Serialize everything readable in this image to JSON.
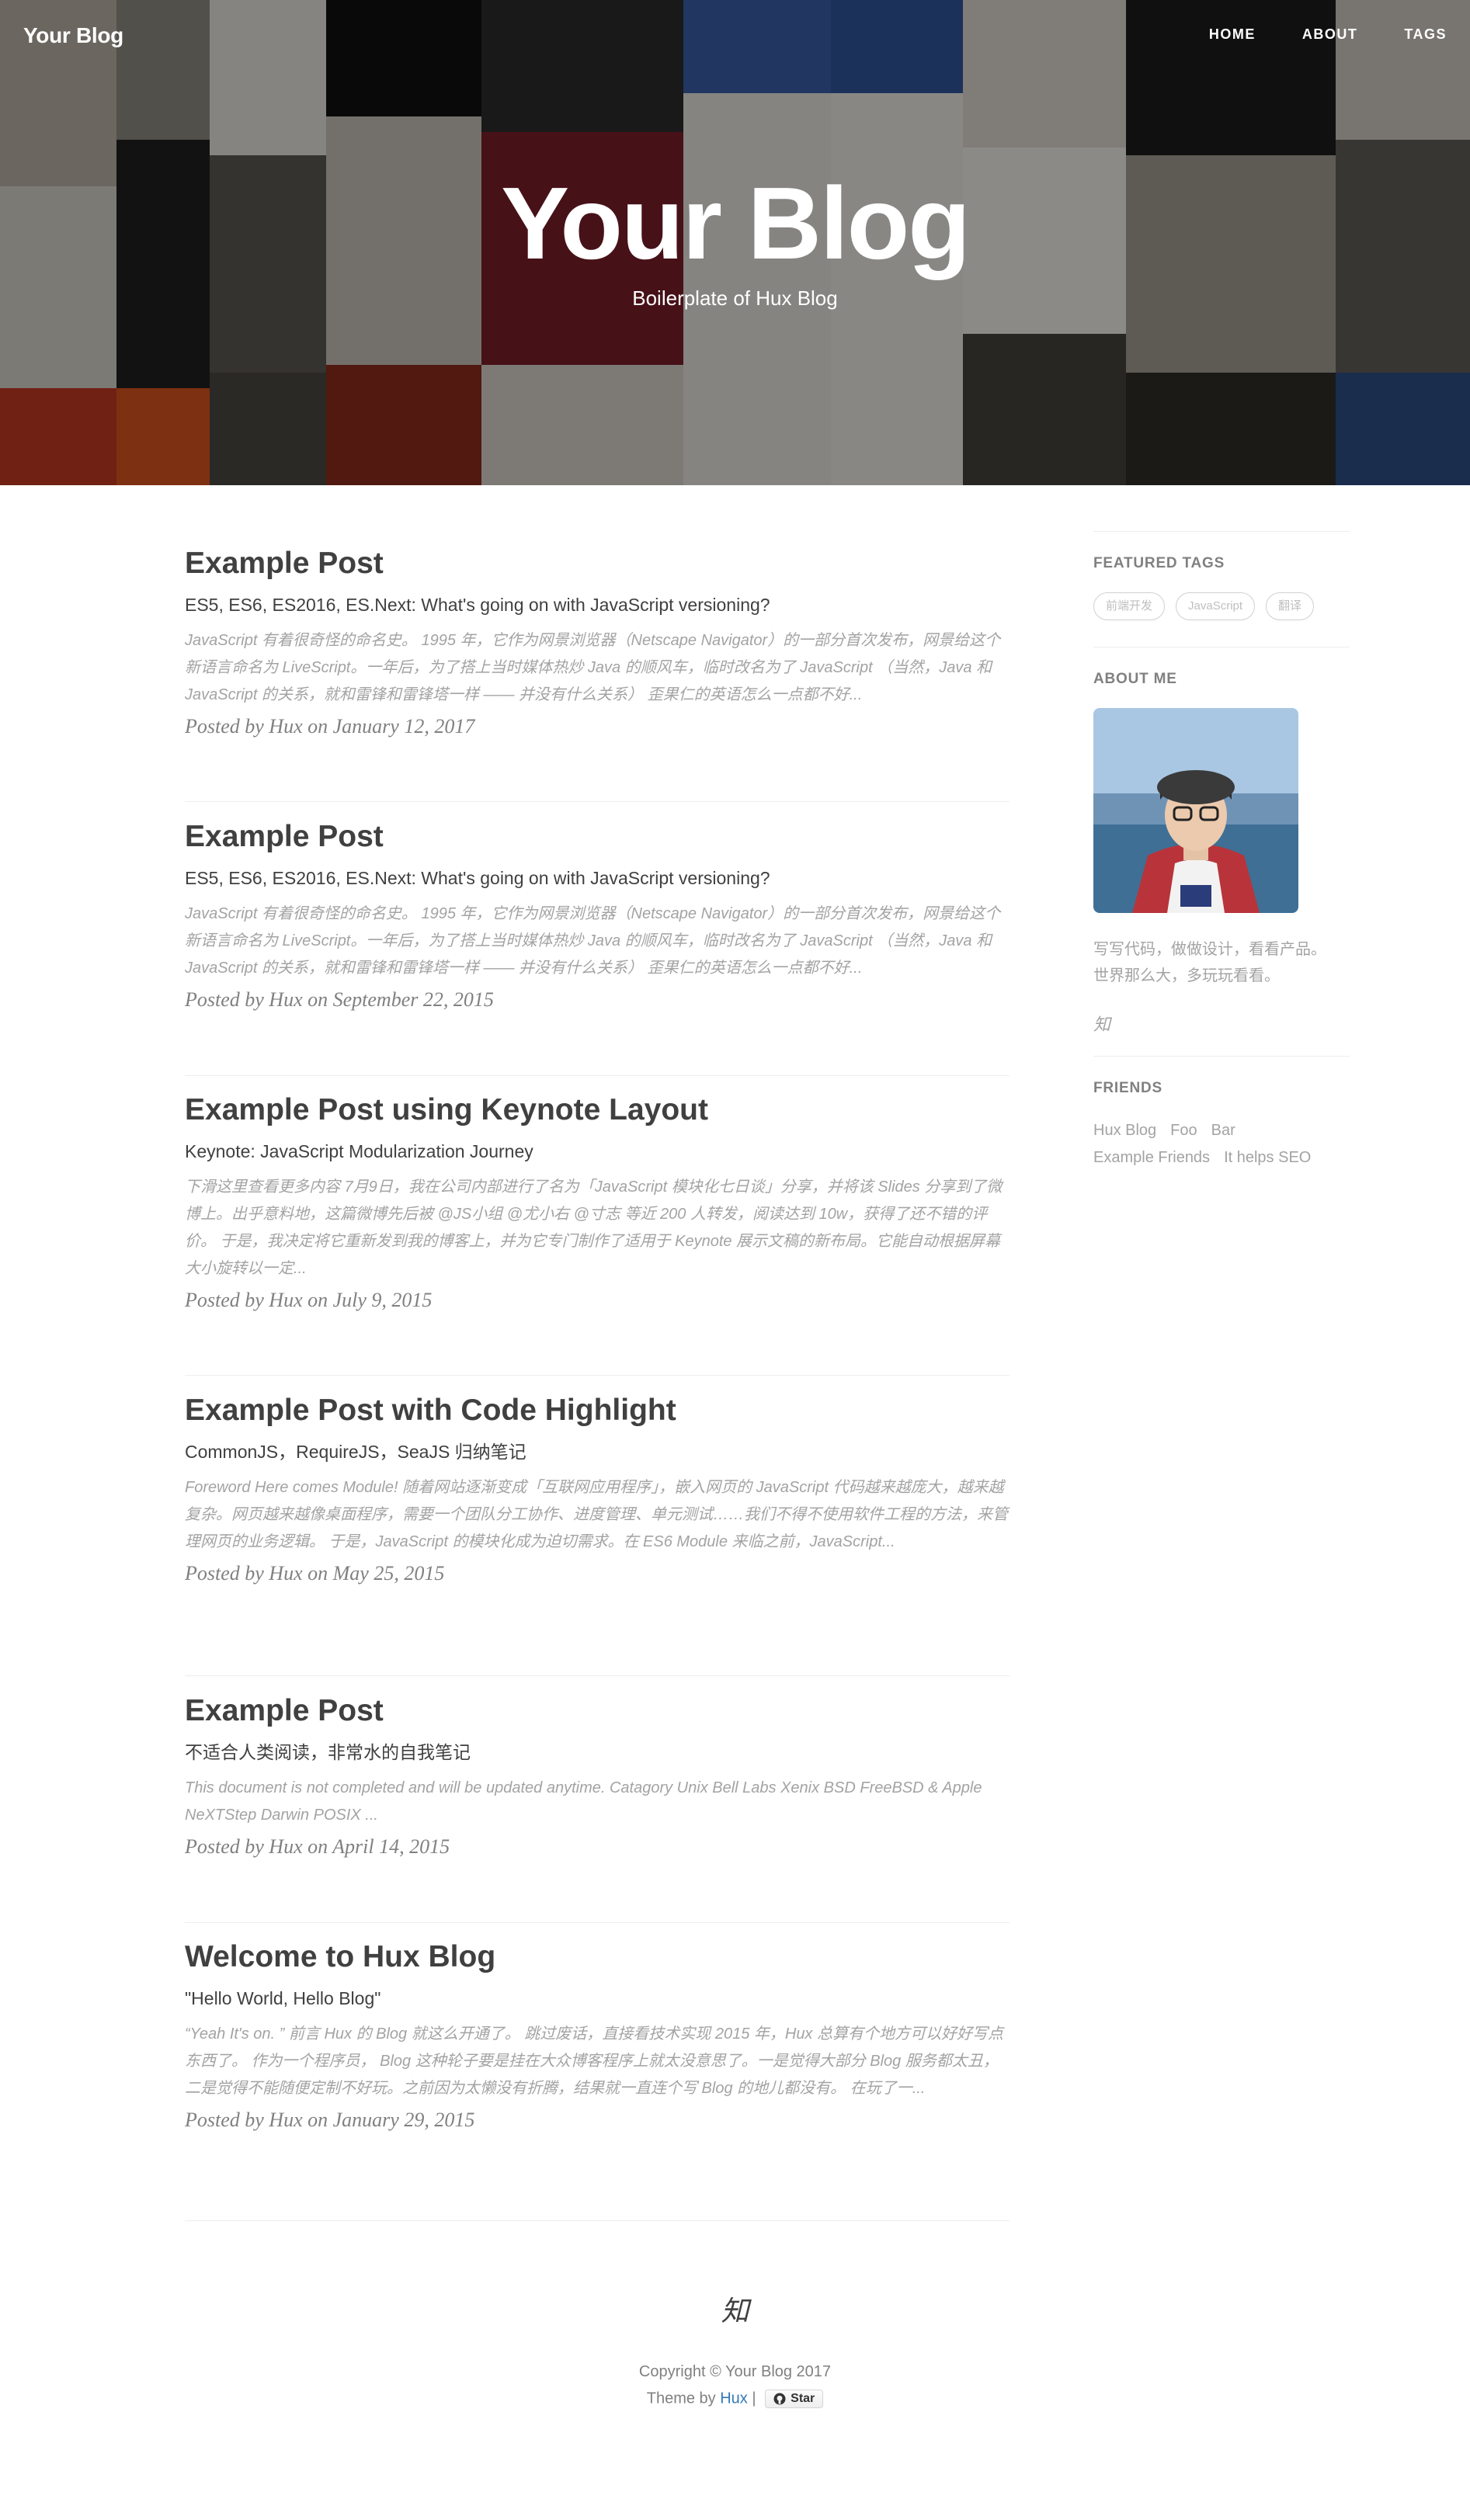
{
  "header": {
    "brand": "Your Blog",
    "nav": [
      "HOME",
      "ABOUT",
      "TAGS"
    ],
    "title": "Your Blog",
    "subtitle": "Boilerplate of Hux Blog"
  },
  "posts": [
    {
      "title": "Example Post",
      "subtitle": "ES5, ES6, ES2016, ES.Next: What's going on with JavaScript versioning?",
      "excerpt": "JavaScript 有着很奇怪的命名史。 1995 年，它作为网景浏览器（Netscape Navigator）的一部分首次发布，网景给这个新语言命名为 LiveScript。一年后，为了搭上当时媒体热炒 Java 的顺风车，临时改名为了 JavaScript （当然，Java 和 JavaScript 的关系，就和雷锋和雷锋塔一样 —— 并没有什么关系） 歪果仁的英语怎么一点都不好...",
      "meta": "Posted by Hux on January 12, 2017"
    },
    {
      "title": "Example Post",
      "subtitle": "ES5, ES6, ES2016, ES.Next: What's going on with JavaScript versioning?",
      "excerpt": "JavaScript 有着很奇怪的命名史。 1995 年，它作为网景浏览器（Netscape Navigator）的一部分首次发布，网景给这个新语言命名为 LiveScript。一年后，为了搭上当时媒体热炒 Java 的顺风车，临时改名为了 JavaScript （当然，Java 和 JavaScript 的关系，就和雷锋和雷锋塔一样 —— 并没有什么关系） 歪果仁的英语怎么一点都不好...",
      "meta": "Posted by Hux on September 22, 2015"
    },
    {
      "title": "Example Post using Keynote Layout",
      "subtitle": "Keynote: JavaScript Modularization Journey",
      "excerpt": "下滑这里查看更多内容 7月9日，我在公司内部进行了名为「JavaScript 模块化七日谈」分享，并将该 Slides 分享到了微博上。出乎意料地，这篇微博先后被 @JS小组 @尤小右 @寸志 等近 200 人转发，阅读达到 10w，获得了还不错的评价。 于是，我决定将它重新发到我的博客上，并为它专门制作了适用于 Keynote 展示文稿的新布局。它能自动根据屏幕大小旋转以一定...",
      "meta": "Posted by Hux on July 9, 2015"
    },
    {
      "title": "Example Post with Code Highlight",
      "subtitle": "CommonJS，RequireJS，SeaJS 归纳笔记",
      "excerpt": "Foreword Here comes Module! 随着网站逐渐变成「互联网应用程序」，嵌入网页的 JavaScript 代码越来越庞大，越来越复杂。网页越来越像桌面程序，需要一个团队分工协作、进度管理、单元测试……我们不得不使用软件工程的方法，来管理网页的业务逻辑。 于是，JavaScript 的模块化成为迫切需求。在 ES6 Module 来临之前，JavaScript...",
      "meta": "Posted by Hux on May 25, 2015"
    },
    {
      "title": "Example Post",
      "subtitle": "不适合人类阅读，非常水的自我笔记",
      "excerpt": "This document is not completed and will be updated anytime. Catagory Unix Bell Labs Xenix BSD FreeBSD & Apple NeXTStep Darwin POSIX ...",
      "meta": "Posted by Hux on April 14, 2015"
    },
    {
      "title": "Welcome to Hux Blog",
      "subtitle": "\"Hello World, Hello Blog\"",
      "excerpt": "“Yeah It's on. ” 前言 Hux 的 Blog 就这么开通了。 跳过废话，直接看技术实现 2015 年，Hux 总算有个地方可以好好写点东西了。 作为一个程序员， Blog 这种轮子要是挂在大众博客程序上就太没意思了。一是觉得大部分 Blog 服务都太丑，二是觉得不能随便定制不好玩。之前因为太懒没有折腾，结果就一直连个写 Blog 的地儿都没有。 在玩了一...",
      "meta": "Posted by Hux on January 29, 2015"
    }
  ],
  "sidebar": {
    "featured_tags_heading": "FEATURED TAGS",
    "tags": [
      "前端开发",
      "JavaScript",
      "翻译"
    ],
    "about_heading": "ABOUT ME",
    "about_line1": "写写代码，做做设计，看看产品。",
    "about_line2": "世界那么大，多玩玩看看。",
    "zhi": "知",
    "friends_heading": "FRIENDS",
    "friends": [
      "Hux Blog",
      "Foo",
      "Bar",
      "Example Friends",
      "It helps SEO"
    ]
  },
  "footer": {
    "zhi": "知",
    "copyright": "Copyright © Your Blog 2017",
    "theme_by": "Theme by",
    "theme_author": "Hux",
    "separator": "|",
    "star_label": "Star"
  }
}
